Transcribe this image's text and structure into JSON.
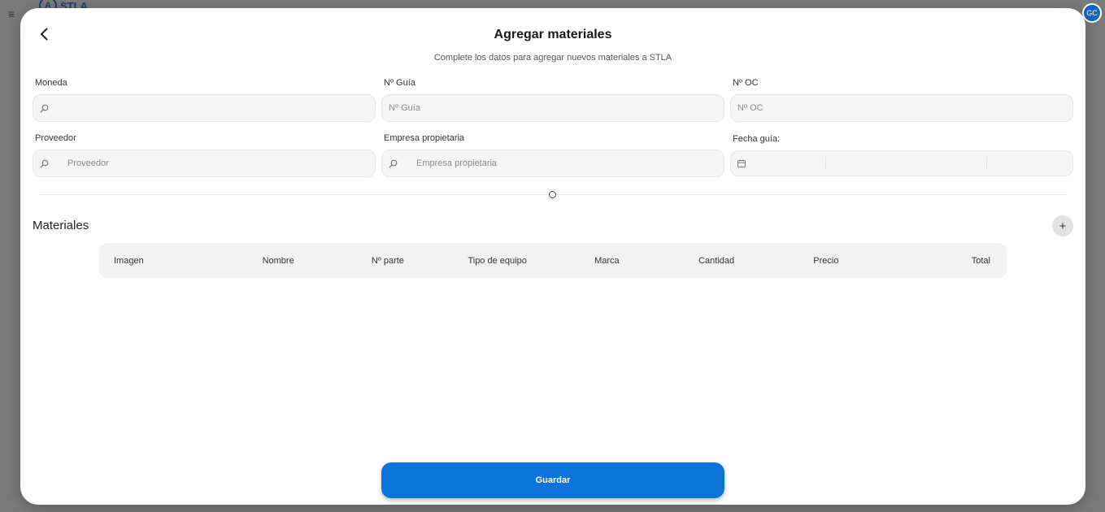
{
  "backdrop": {
    "menu_icon": "menu-icon",
    "logo_text": "STLA",
    "avatar_initials": "GC"
  },
  "modal": {
    "title": "Agregar materiales",
    "subtitle": "Complete los datos para agregar nuevos materiales a STLA"
  },
  "form": {
    "moneda": {
      "label": "Moneda",
      "placeholder": ""
    },
    "guia": {
      "label": "Nº Guía",
      "placeholder": "Nº Guía"
    },
    "oc": {
      "label": "Nº OC",
      "placeholder": "Nº OC"
    },
    "proveedor": {
      "label": "Proveedor",
      "placeholder": "Proveedor"
    },
    "empresa": {
      "label": "Empresa propietaria",
      "placeholder": "Empresa propietaria"
    },
    "fecha": {
      "label": "Fecha guía:"
    }
  },
  "materials": {
    "title": "Materiales",
    "columns": [
      "Imagen",
      "Nombre",
      "Nº parte",
      "Tipo de equipo",
      "Marca",
      "Cantidad",
      "Precio",
      "Total"
    ]
  },
  "actions": {
    "save_label": "Guardar"
  },
  "colors": {
    "primary": "#0b73d9",
    "avatar": "#1565c0"
  }
}
